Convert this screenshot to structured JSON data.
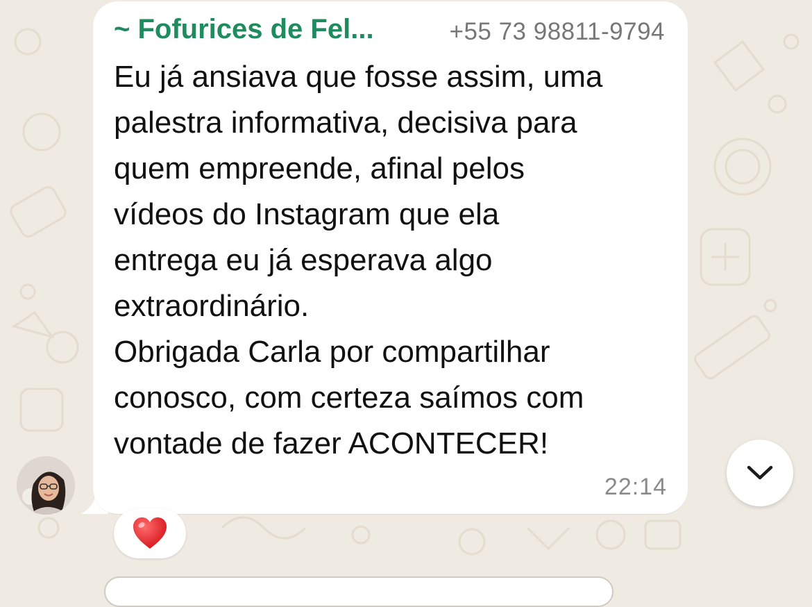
{
  "message": {
    "sender_name": "~ Fofurices de Fel...",
    "sender_phone": "+55 73 98811-9794",
    "lines": [
      "Eu já ansiava que fosse assim, uma",
      "palestra informativa, decisiva para",
      "quem empreende, afinal pelos",
      "vídeos do Instagram que ela",
      "entrega eu já esperava algo",
      "extraordinário.",
      "Obrigada Carla por compartilhar",
      "conosco, com certeza saímos com",
      "vontade de fazer ACONTECER!"
    ],
    "time": "22:14",
    "reaction_icon": "red-heart-icon"
  },
  "colors": {
    "background": "#efeae2",
    "bubble": "#ffffff",
    "sender_name": "#1f8b5f",
    "phone": "#777777",
    "timestamp": "#8a8a8a"
  },
  "icons": {
    "avatar": "avatar",
    "scroll_down": "chevron-down-icon"
  }
}
